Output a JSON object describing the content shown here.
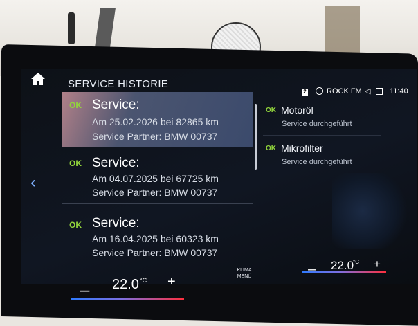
{
  "header": {
    "title": "SERVICE HISTORIE"
  },
  "status_bar": {
    "badge": "2",
    "radio_station": "ROCK FM",
    "time": "11:40"
  },
  "history": [
    {
      "status": "OK",
      "heading": "Service:",
      "line1": "Am 25.02.2026 bei 82865 km",
      "line2": "Service Partner: BMW 00737",
      "selected": true
    },
    {
      "status": "OK",
      "heading": "Service:",
      "line1": "Am 04.07.2025 bei 67725 km",
      "line2": "Service Partner: BMW 00737",
      "selected": false
    },
    {
      "status": "OK",
      "heading": "Service:",
      "line1": "Am 16.04.2025 bei 60323 km",
      "line2": "Service Partner: BMW 00737",
      "selected": false
    }
  ],
  "details": [
    {
      "status": "OK",
      "name": "Motoröl",
      "sub": "Service durchgeführt"
    },
    {
      "status": "OK",
      "name": "Mikrofilter",
      "sub": "Service durchgeführt"
    }
  ],
  "climate": {
    "left_temp": "22.0",
    "right_temp": "22.0",
    "unit": "°C",
    "minus": "–",
    "plus": "+",
    "menu_label_1": "KLIMA",
    "menu_label_2": "MENÜ"
  },
  "icons": {
    "home": "home-icon",
    "back": "chevron-left-icon",
    "radio": "radio-icon",
    "volume": "volume-icon",
    "message": "message-icon"
  },
  "colors": {
    "ok_green": "#92d53c",
    "selection": "#3b4a6c",
    "accent_blue": "#2f7bff",
    "accent_red": "#ff2f3d"
  }
}
